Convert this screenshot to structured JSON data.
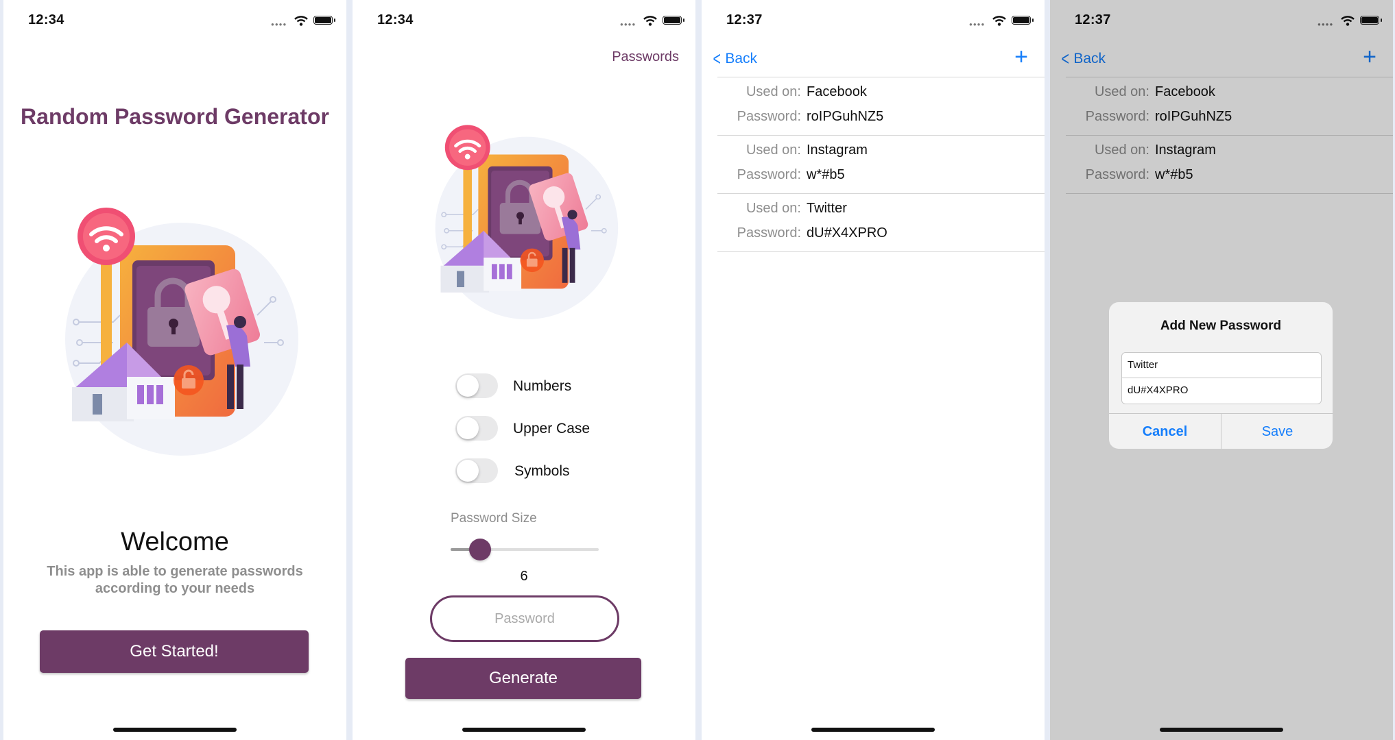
{
  "screens": [
    {
      "time": "12:34",
      "title": "Random Password Generator",
      "welcome": "Welcome",
      "description": "This app is able to generate passwords according to your needs",
      "button": "Get Started!"
    },
    {
      "time": "12:34",
      "nav_link": "Passwords",
      "toggles": [
        {
          "label": "Numbers",
          "on": false
        },
        {
          "label": "Upper Case",
          "on": false
        },
        {
          "label": "Symbols",
          "on": false
        }
      ],
      "slider_label": "Password Size",
      "slider_value": "6",
      "slider_fraction": 0.2,
      "password_placeholder": "Password",
      "button": "Generate"
    },
    {
      "time": "12:37",
      "back": "Back",
      "used_on_label": "Used on:",
      "password_label": "Password:",
      "entries": [
        {
          "used_on": "Facebook",
          "password": "roIPGuhNZ5"
        },
        {
          "used_on": "Instagram",
          "password": "w*#b5"
        },
        {
          "used_on": "Twitter",
          "password": "dU#X4XPRO"
        }
      ]
    },
    {
      "time": "12:37",
      "back": "Back",
      "used_on_label": "Used on:",
      "password_label": "Password:",
      "entries": [
        {
          "used_on": "Facebook",
          "password": "roIPGuhNZ5"
        },
        {
          "used_on": "Instagram",
          "password": "w*#b5"
        }
      ],
      "alert": {
        "title": "Add New Password",
        "field1": "Twitter",
        "field2": "dU#X4XPRO",
        "cancel": "Cancel",
        "save": "Save"
      }
    }
  ],
  "colors": {
    "accent": "#6d3b66",
    "ios_blue": "#157efb"
  },
  "icons": [
    "wifi-icon",
    "battery-icon",
    "chevron-left-icon",
    "plus-icon",
    "lock-icon",
    "key-icon"
  ]
}
